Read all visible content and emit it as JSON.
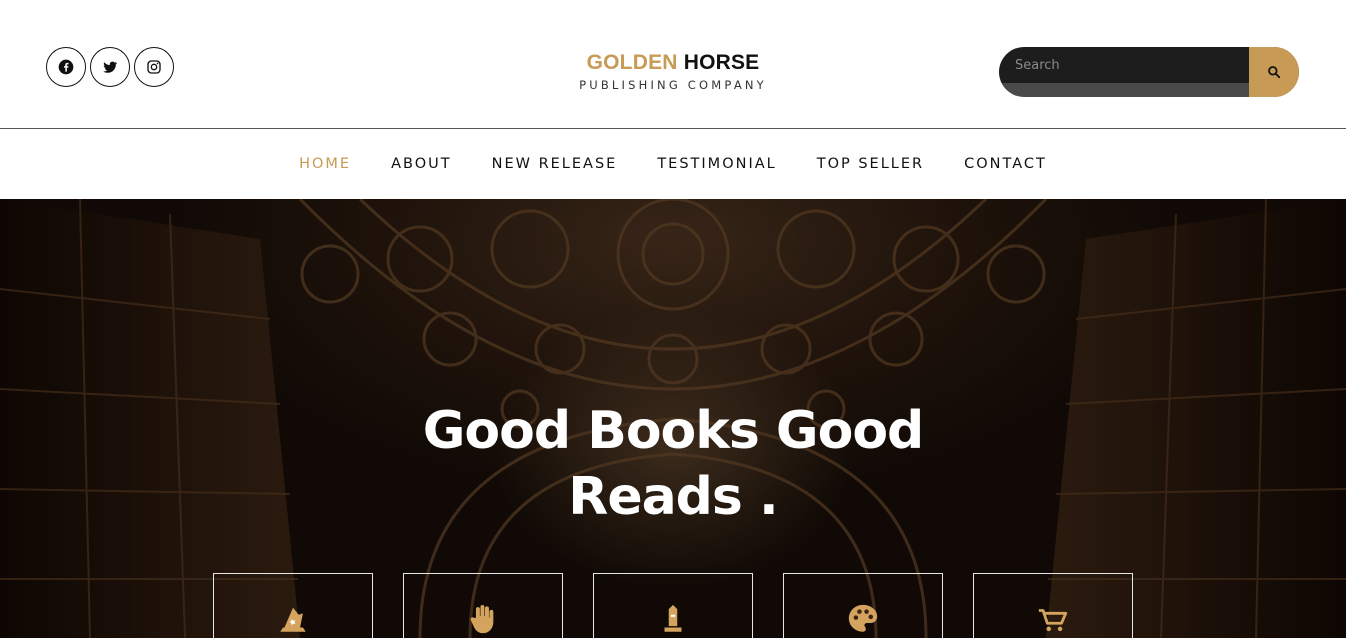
{
  "header": {
    "socials": [
      {
        "icon": "facebook-icon",
        "label": "Facebook"
      },
      {
        "icon": "twitter-icon",
        "label": "Twitter"
      },
      {
        "icon": "instagram-icon",
        "label": "Instagram"
      }
    ],
    "logo": {
      "title_gold": "GOLDEN",
      "title_dark": "HORSE",
      "subtitle": "PUBLISHING COMPANY"
    },
    "search": {
      "placeholder": "Search",
      "button_icon": "search-icon"
    }
  },
  "nav": {
    "items": [
      {
        "label": "HOME",
        "active": true
      },
      {
        "label": "ABOUT",
        "active": false
      },
      {
        "label": "NEW RELEASE",
        "active": false
      },
      {
        "label": "TESTIMONIAL",
        "active": false
      },
      {
        "label": "TOP SELLER",
        "active": false
      },
      {
        "label": "CONTACT",
        "active": false
      }
    ]
  },
  "hero": {
    "title_line1": "Good Books Good",
    "title_line2": "Reads .",
    "features": [
      {
        "icon": "wizard-hat-icon"
      },
      {
        "icon": "hand-icon"
      },
      {
        "icon": "monument-icon"
      },
      {
        "icon": "palette-icon"
      },
      {
        "icon": "shopping-cart-icon"
      }
    ]
  },
  "colors": {
    "accent": "#c79a55",
    "text": "#111111",
    "search_bg": "#1d1d1d"
  }
}
